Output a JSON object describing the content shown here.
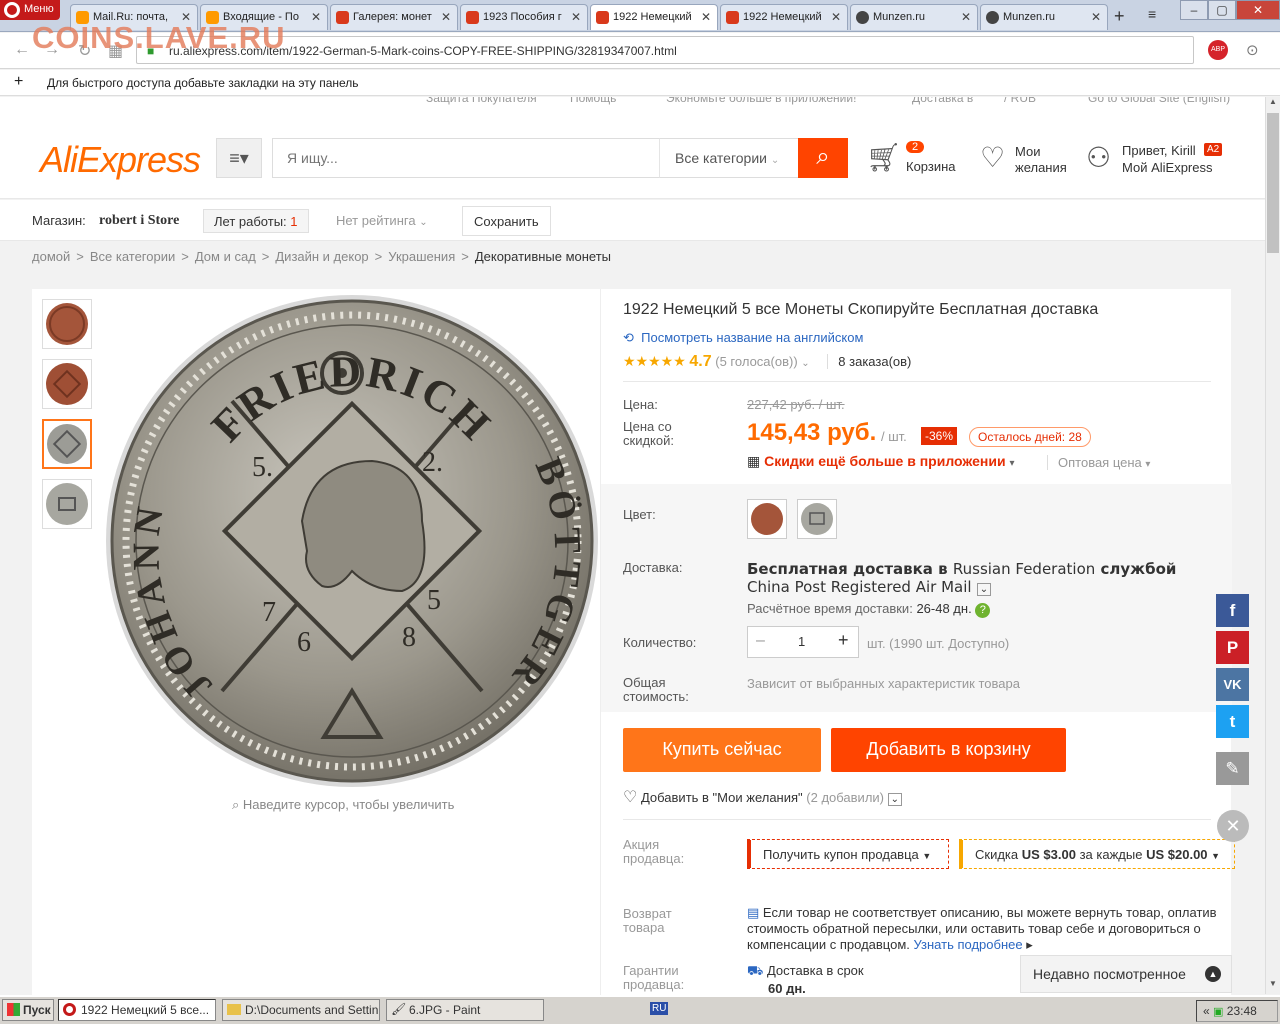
{
  "browser": {
    "menu_label": "Меню",
    "tabs": [
      {
        "label": "Mail.Ru: почта,",
        "color": "#ff9a00"
      },
      {
        "label": "Входящие - По",
        "color": "#ff9a00"
      },
      {
        "label": "Галерея: монет",
        "color": "#d9391b"
      },
      {
        "label": "1923 Пособия г",
        "color": "#d9391b"
      },
      {
        "label": "1922 Немецкий",
        "color": "#d9391b"
      },
      {
        "label": "1922 Немецкий",
        "color": "#d9391b"
      },
      {
        "label": "Munzen.ru",
        "color": "#444"
      },
      {
        "label": "Munzen.ru",
        "color": "#444"
      }
    ],
    "url": "ru.aliexpress.com/item/1922-German-5-Mark-coins-COPY-FREE-SHIPPING/32819347007.html",
    "bookmarks_hint": "Для быстрого доступа добавьте закладки на эту панель",
    "watermark": "COINS.LAVE.RU"
  },
  "topstrip": [
    "Защита Покупателя",
    "Помощь",
    "Экономьте больше в приложении!",
    "Доставка в",
    "/ RUB",
    "Go to Global Site (English)"
  ],
  "header": {
    "logo": "AliExpress",
    "search_placeholder": "Я ищу...",
    "category": "Все категории",
    "cart_count": "2",
    "cart_label": "Корзина",
    "wish_line1": "Мои",
    "wish_line2": "желания",
    "greet": "Привет, Kirill",
    "greet_badge": "A2",
    "my_ali": "Мой AliExpress"
  },
  "store": {
    "label": "Магазин:",
    "name": "robert i Store",
    "years_label": "Лет работы:",
    "years_value": "1",
    "rating": "Нет рейтинга",
    "save": "Сохранить"
  },
  "breadcrumb": [
    "домой",
    ">",
    "Все категории",
    ">",
    "Дом и сад",
    ">",
    "Дизайн и декор",
    ">",
    "Украшения",
    ">",
    "Декоративные монеты"
  ],
  "product": {
    "title": "1922 Немецкий 5 все Монеты Скопируйте Бесплатная доставка",
    "translate_link": "Посмотреть название на английском",
    "rating_value": "4.7",
    "votes": "(5 голоса(ов))",
    "orders": "8 заказа(ов)",
    "price_label": "Цена:",
    "old_price": "227,42 руб. / шт.",
    "discount_label_1": "Цена со",
    "discount_label_2": "скидкой:",
    "price": "145,43 руб.",
    "per_unit": "/ шт.",
    "discount_pct": "-36%",
    "days_left": "Осталось дней: 28",
    "app_discount": "Скидки ещё больше в приложении",
    "wholesale": "Оптовая цена",
    "color_label": "Цвет:",
    "shipping_label": "Доставка:",
    "shipping_text_a": "Бесплатная доставка в",
    "shipping_text_b": "Russian Federation",
    "shipping_text_c": "службой",
    "shipping_text_d": "China Post Registered Air Mail",
    "delivery_time_label": "Расчётное время доставки:",
    "delivery_time": "26-48 дн.",
    "qty_label": "Количество:",
    "qty_value": "1",
    "qty_avail": "шт. (1990 шт. Доступно)",
    "total_label_1": "Общая",
    "total_label_2": "стоимость:",
    "total_value": "Зависит от выбранных характеристик товара",
    "buy_now": "Купить сейчас",
    "add_cart": "Добавить в корзину",
    "add_wish": "Добавить в \"Мои желания\"",
    "wish_count": "(2 добавили)",
    "promo_label_1": "Акция",
    "promo_label_2": "продавца:",
    "coupon": "Получить купон продавца",
    "promo_text_a": "Скидка",
    "promo_text_b": "US $3.00",
    "promo_text_c": "за каждые",
    "promo_text_d": "US $20.00",
    "return_label_1": "Возврат",
    "return_label_2": "товара",
    "return_text": "Если товар не соответствует описанию, вы можете вернуть товар, оплатив стоимость обратной пересылки, или оставить товар себе и договориться о компенсации с продавцом.",
    "return_more": "Узнать подробнее",
    "guarantee_label_1": "Гарантии",
    "guarantee_label_2": "продавца:",
    "guarantee_text": "Доставка в срок",
    "guarantee_days": "60 дн.",
    "zoom_hint": "Наведите курсор, чтобы увеличить",
    "coin_text_top": "FRIEDRICH",
    "coin_text_left": "JOHANN",
    "coin_text_right": "BÖTTGER",
    "coin_nums": [
      "5.",
      "2.",
      "7",
      "6",
      "8",
      "5"
    ]
  },
  "recent": "Недавно посмотренное",
  "taskbar": {
    "start": "Пуск",
    "items": [
      "1922 Немецкий 5 все...",
      "D:\\Documents and Settin...",
      "6.JPG - Paint"
    ],
    "lang": "RU",
    "clock": "23:48"
  }
}
